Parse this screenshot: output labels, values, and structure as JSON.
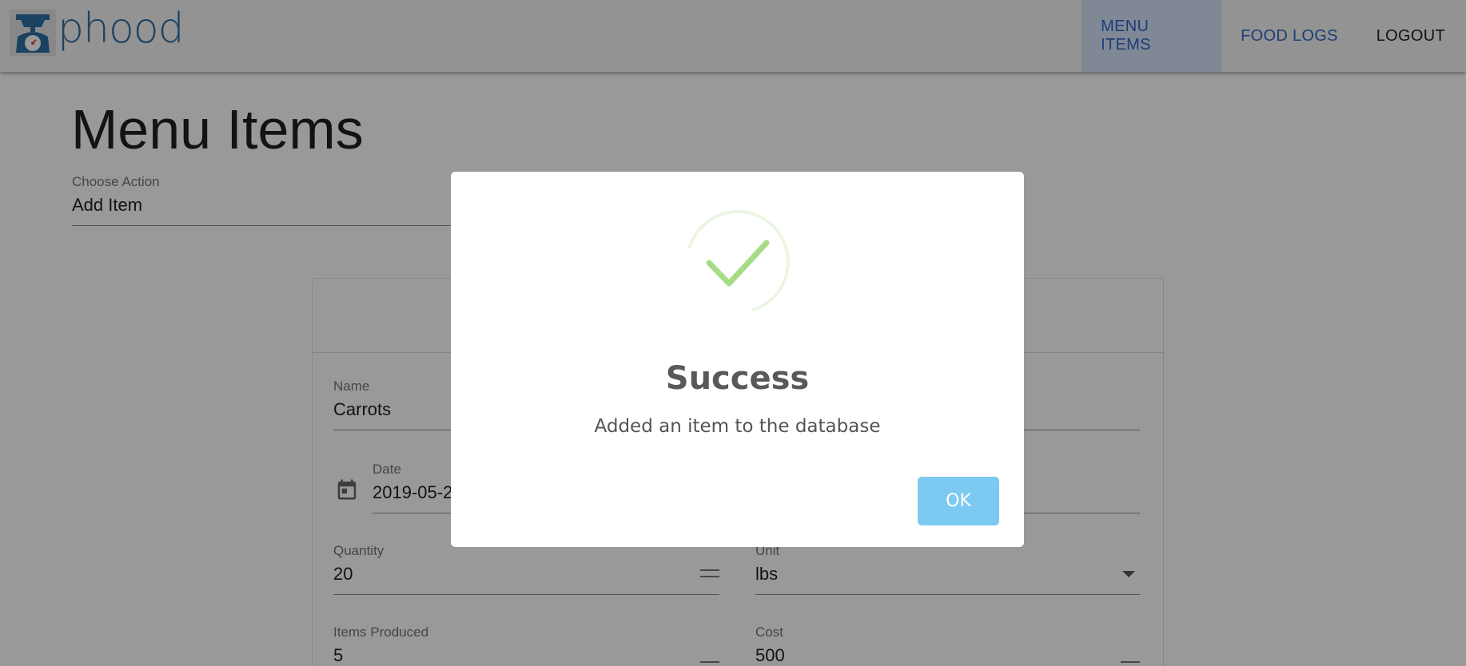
{
  "app": {
    "logo_text": "phood"
  },
  "nav": {
    "items": [
      {
        "label": "MENU ITEMS"
      },
      {
        "label": "FOOD LOGS"
      },
      {
        "label": "LOGOUT"
      }
    ]
  },
  "page": {
    "title": "Menu Items",
    "action": {
      "label": "Choose Action",
      "value": "Add Item"
    }
  },
  "form": {
    "name": {
      "label": "Name",
      "value": "Carrots"
    },
    "date": {
      "label": "Date",
      "value": "2019-05-2"
    },
    "quantity": {
      "label": "Quantity",
      "value": "20"
    },
    "unit": {
      "label": "Unit",
      "value": "lbs"
    },
    "items_produced": {
      "label": "Items Produced",
      "value": "5"
    },
    "cost": {
      "label": "Cost",
      "value": "500"
    }
  },
  "dialog": {
    "title": "Success",
    "message": "Added an item to the database",
    "ok_label": "OK"
  },
  "colors": {
    "accent": "#2f67c7",
    "success": "#a5dc86",
    "ok_button": "#7cc9f1"
  }
}
